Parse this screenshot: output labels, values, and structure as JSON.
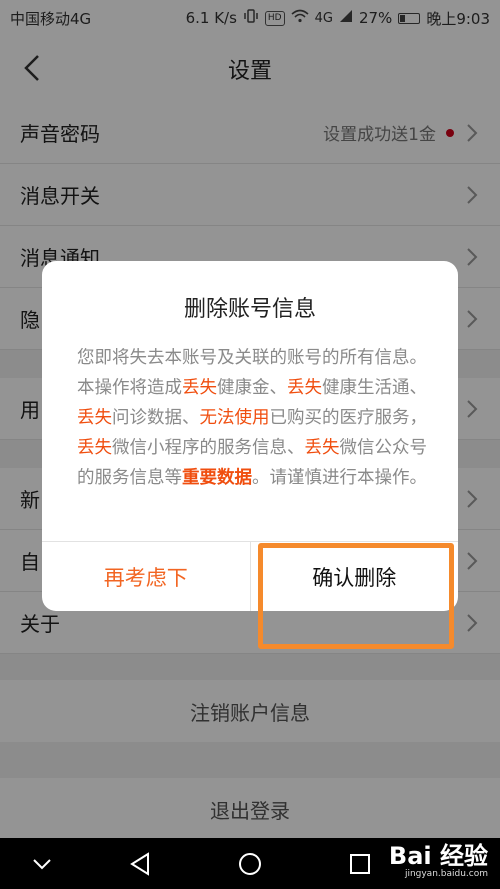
{
  "status_bar": {
    "carrier": "中国移动4G",
    "speed": "6.1 K/s",
    "signal": "4G",
    "battery": "27%",
    "time": "晚上9:03"
  },
  "header": {
    "title": "设置"
  },
  "settings": {
    "voice_password": {
      "label": "声音密码",
      "value": "设置成功送1金"
    },
    "msg_switch": {
      "label": "消息开关"
    },
    "msg_notify": {
      "label": "消息通知"
    },
    "privacy": {
      "label": "隐"
    },
    "usage": {
      "label": "用"
    },
    "new_item": {
      "label": "新"
    },
    "self_item": {
      "label": "自"
    },
    "about": {
      "label": "关于"
    }
  },
  "cancel_account_label": "注销账户信息",
  "logout_label": "退出登录",
  "dialog": {
    "title": "删除账号信息",
    "body": {
      "p1": "您即将失去本账号及关联的账号的所有信息。本操作将造成",
      "h1": "丢失",
      "p2": "健康金、",
      "h2": "丢失",
      "p3": "健康生活通、",
      "h3": "丢失",
      "p4": "问诊数据、",
      "h4": "无法使用",
      "p5": "已购买的医疗服务，",
      "h5": "丢失",
      "p6": "微信小程序的服务信息、",
      "h6": "丢失",
      "p7": "微信公众号的服务信息等",
      "h7": "重要数据",
      "p8": "。请谨慎进行本操作。"
    },
    "cancel_label": "再考虑下",
    "confirm_label": "确认删除"
  },
  "watermark": {
    "main": "Bai 经验",
    "sub": "jingyan.baidu.com"
  },
  "colors": {
    "accent": "#f26522",
    "highlight_box": "#f58a2c",
    "danger_dot": "#d0021b"
  }
}
